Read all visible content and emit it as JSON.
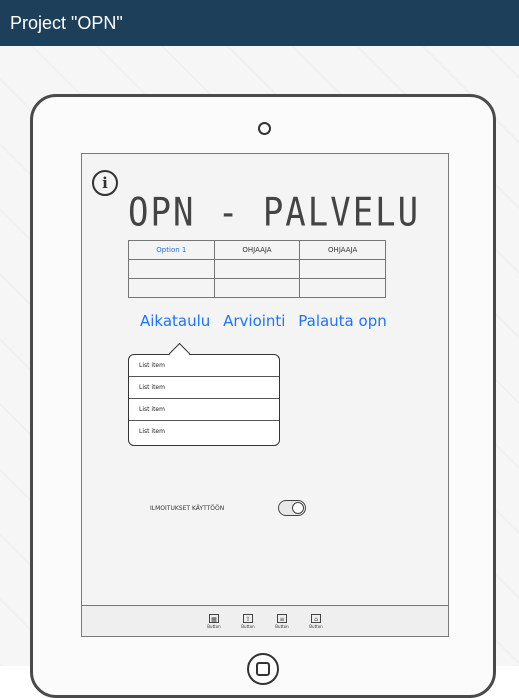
{
  "header": {
    "title": "Project \"OPN\""
  },
  "screen": {
    "title": "OPN - PALVELU",
    "table": {
      "rows": [
        [
          "Option 1",
          "OHJAAJA",
          "OHJAAJA"
        ],
        [
          "",
          "",
          ""
        ],
        [
          "",
          "",
          ""
        ]
      ]
    },
    "tabs": [
      "Aikataulu",
      "Arviointi",
      "Palauta opn"
    ],
    "popover": {
      "items": [
        "List item",
        "List item",
        "List item",
        "List item"
      ]
    },
    "notifications": {
      "label": "ILMOITUKSET KÄYTTÖÖN",
      "enabled": true
    },
    "bottom_buttons": [
      {
        "label": "Button",
        "icon": "calendar-icon"
      },
      {
        "label": "Button",
        "icon": "upload-icon"
      },
      {
        "label": "Button",
        "icon": "document-icon"
      },
      {
        "label": "Button",
        "icon": "home-icon"
      }
    ]
  }
}
